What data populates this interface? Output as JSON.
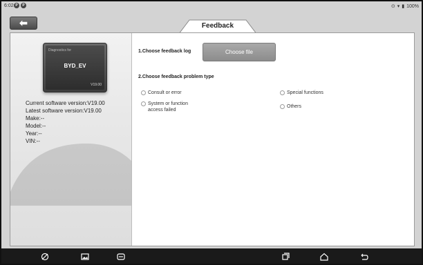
{
  "statusbar": {
    "time": "6:02",
    "battery": "100%"
  },
  "tab": {
    "title": "Feedback"
  },
  "vehicle": {
    "diagnostics_label": "Diagnostics for",
    "name": "BYD_EV",
    "version": "V19.00"
  },
  "info": {
    "current_software": "Current software version:V19.00",
    "latest_software": "Latest software version:V19.00",
    "make": "Make:--",
    "model": "Model:--",
    "year": "Year:--",
    "vin": "VIN:--"
  },
  "feedback": {
    "step1_label": "1.Choose feedback log",
    "choose_file_label": "Choose file",
    "step2_label": "2.Choose feedback problem type",
    "options": [
      {
        "label": "Consult or error"
      },
      {
        "label": "Special functions"
      },
      {
        "label_line1": "System or function",
        "label_line2": "access failed"
      },
      {
        "label": "Others"
      }
    ]
  },
  "icons": [
    "back-icon",
    "assistant-icon",
    "gallery-icon",
    "vci-icon",
    "recent-apps-icon",
    "home-icon",
    "return-icon"
  ]
}
